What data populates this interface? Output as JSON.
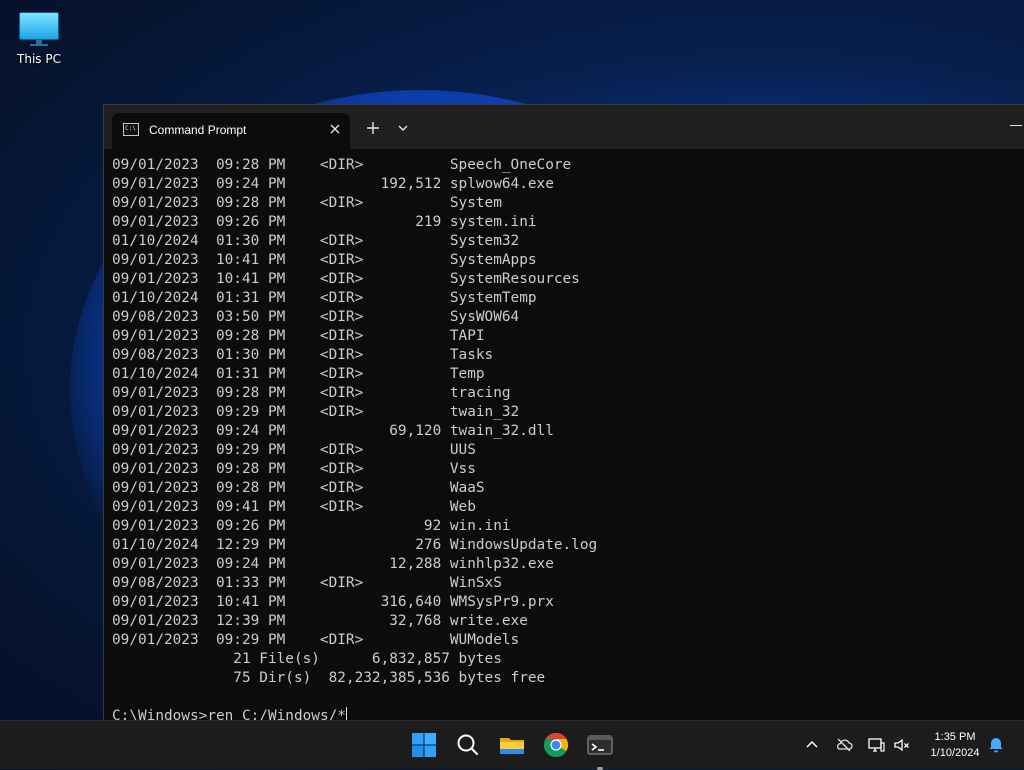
{
  "desktop": {
    "icons": [
      {
        "label": "This PC",
        "icon": "monitor-icon"
      }
    ]
  },
  "window": {
    "tab_title": "Command Prompt",
    "tab_icon": "cmd-icon"
  },
  "console": {
    "lines": [
      "09/01/2023  09:28 PM    <DIR>          Speech_OneCore",
      "09/01/2023  09:24 PM           192,512 splwow64.exe",
      "09/01/2023  09:28 PM    <DIR>          System",
      "09/01/2023  09:26 PM               219 system.ini",
      "01/10/2024  01:30 PM    <DIR>          System32",
      "09/01/2023  10:41 PM    <DIR>          SystemApps",
      "09/01/2023  10:41 PM    <DIR>          SystemResources",
      "01/10/2024  01:31 PM    <DIR>          SystemTemp",
      "09/08/2023  03:50 PM    <DIR>          SysWOW64",
      "09/01/2023  09:28 PM    <DIR>          TAPI",
      "09/08/2023  01:30 PM    <DIR>          Tasks",
      "01/10/2024  01:31 PM    <DIR>          Temp",
      "09/01/2023  09:28 PM    <DIR>          tracing",
      "09/01/2023  09:29 PM    <DIR>          twain_32",
      "09/01/2023  09:24 PM            69,120 twain_32.dll",
      "09/01/2023  09:29 PM    <DIR>          UUS",
      "09/01/2023  09:28 PM    <DIR>          Vss",
      "09/01/2023  09:28 PM    <DIR>          WaaS",
      "09/01/2023  09:41 PM    <DIR>          Web",
      "09/01/2023  09:26 PM                92 win.ini",
      "01/10/2024  12:29 PM               276 WindowsUpdate.log",
      "09/01/2023  09:24 PM            12,288 winhlp32.exe",
      "09/08/2023  01:33 PM    <DIR>          WinSxS",
      "09/01/2023  10:41 PM           316,640 WMSysPr9.prx",
      "09/01/2023  12:39 PM            32,768 write.exe",
      "09/01/2023  09:29 PM    <DIR>          WUModels",
      "              21 File(s)      6,832,857 bytes",
      "              75 Dir(s)  82,232,385,536 bytes free",
      ""
    ],
    "prompt": "C:\\Windows>",
    "command": "ren C:/Windows/*"
  },
  "taskbar": {
    "apps": [
      {
        "name": "start-button",
        "icon": "windows-logo-icon"
      },
      {
        "name": "search-button",
        "icon": "search-icon"
      },
      {
        "name": "file-explorer-button",
        "icon": "folder-icon"
      },
      {
        "name": "chrome-button",
        "icon": "chrome-icon"
      },
      {
        "name": "terminal-button",
        "icon": "terminal-icon"
      }
    ],
    "tray": {
      "icons": [
        "chevron-up-icon",
        "cloud-offline-icon",
        "network-icon",
        "volume-muted-icon"
      ],
      "time": "1:35 PM",
      "date": "1/10/2024",
      "notification_icon": "bell-icon"
    }
  },
  "colors": {
    "console_bg": "#0c0c0c",
    "console_text": "#cccccc",
    "titlebar": "#202020",
    "taskbar": "#1c1c1c",
    "windows_blue": "#1f8fff"
  }
}
